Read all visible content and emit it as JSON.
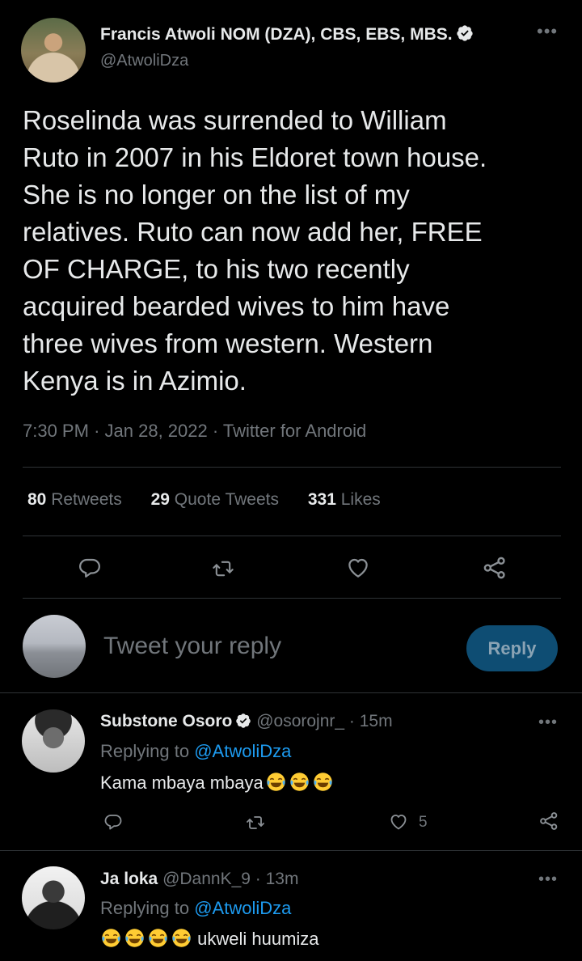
{
  "tweet": {
    "author_name": "Francis Atwoli NOM (DZA), CBS, EBS, MBS.",
    "author_handle": "@AtwoliDza",
    "more_label": "•••",
    "text_lines": [
      "Roselinda was surrended to William",
      "Ruto in 2007 in his Eldoret town house.",
      "She is no longer on the list of my",
      "relatives. Ruto can now add her, FREE",
      "OF CHARGE, to his  two recently",
      "acquired bearded wives to him have",
      "three wives from western. Western",
      "Kenya is in Azimio."
    ],
    "time": "7:30 PM",
    "date": "Jan 28, 2022",
    "source": "Twitter for Android",
    "stats": {
      "retweets_count": "80",
      "retweets_label": "Retweets",
      "quotes_count": "29",
      "quotes_label": "Quote Tweets",
      "likes_count": "331",
      "likes_label": "Likes"
    }
  },
  "compose": {
    "placeholder": "Tweet your reply",
    "reply_button": "Reply"
  },
  "replies": [
    {
      "name": "Substone Osoro",
      "handle": "@osorojnr_",
      "time": "· 15m",
      "replying_prefix": "Replying to",
      "replying_to": "@AtwoliDza",
      "text": "Kama mbaya mbaya",
      "like_count": "5",
      "more_label": "•••"
    },
    {
      "name": "Ja loka",
      "handle": "@DannK_9",
      "time": "· 13m",
      "replying_prefix": "Replying to",
      "replying_to": "@AtwoliDza",
      "text": "ukweli huumiza",
      "more_label": "•••"
    }
  ],
  "colors": {
    "background": "#000000",
    "text": "#e7e9ea",
    "muted": "#71767b",
    "accent": "#1d9bf0",
    "reply_button_bg": "#0e4d73",
    "divider": "#2f3336"
  },
  "icons": {
    "verified": "verified-badge-icon",
    "reply": "comment-icon",
    "retweet": "retweet-icon",
    "like": "heart-icon",
    "share": "share-icon",
    "emoji": "face-with-tears-of-joy-emoji"
  }
}
